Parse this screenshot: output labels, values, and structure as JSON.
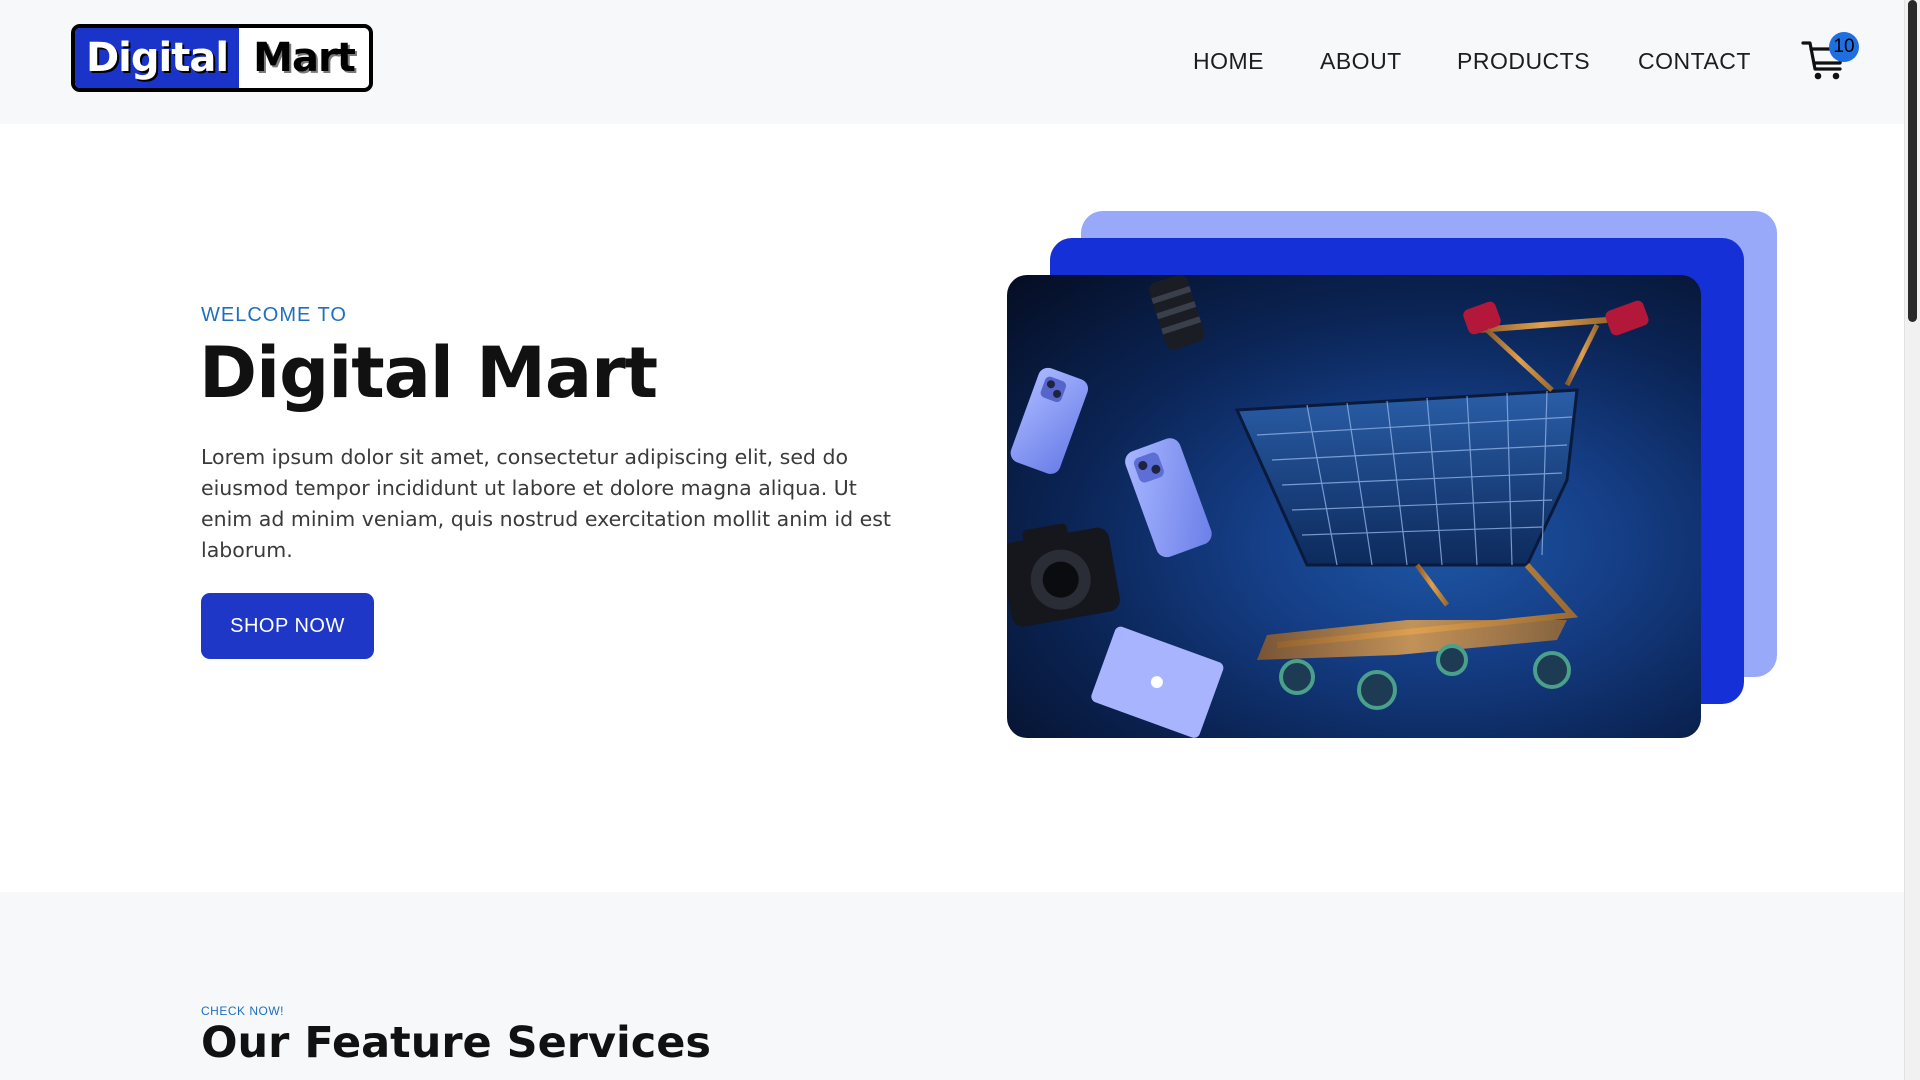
{
  "header": {
    "logo": {
      "part1": "Digital",
      "part2": "Mart"
    },
    "nav": [
      {
        "label": "HOME"
      },
      {
        "label": "ABOUT"
      },
      {
        "label": "PRODUCTS"
      },
      {
        "label": "CONTACT"
      }
    ],
    "cart": {
      "icon": "cart-icon",
      "count": "10"
    }
  },
  "hero": {
    "welcome": "WELCOME TO",
    "title": "Digital Mart",
    "description": "Lorem ipsum dolor sit amet, consectetur adipiscing elit, sed do eiusmod tempor incididunt ut labore et dolore magna aliqua. Ut enim ad minim veniam, quis nostrud exercitation mollit anim id est laborum.",
    "button_label": "SHOP NOW"
  },
  "features": {
    "eyebrow": "CHECK NOW!",
    "title": "Our Feature Services"
  },
  "colors": {
    "brand_blue": "#1f37c6",
    "accent_blue": "#1f6fc0",
    "header_bg": "#f6f8fa"
  }
}
